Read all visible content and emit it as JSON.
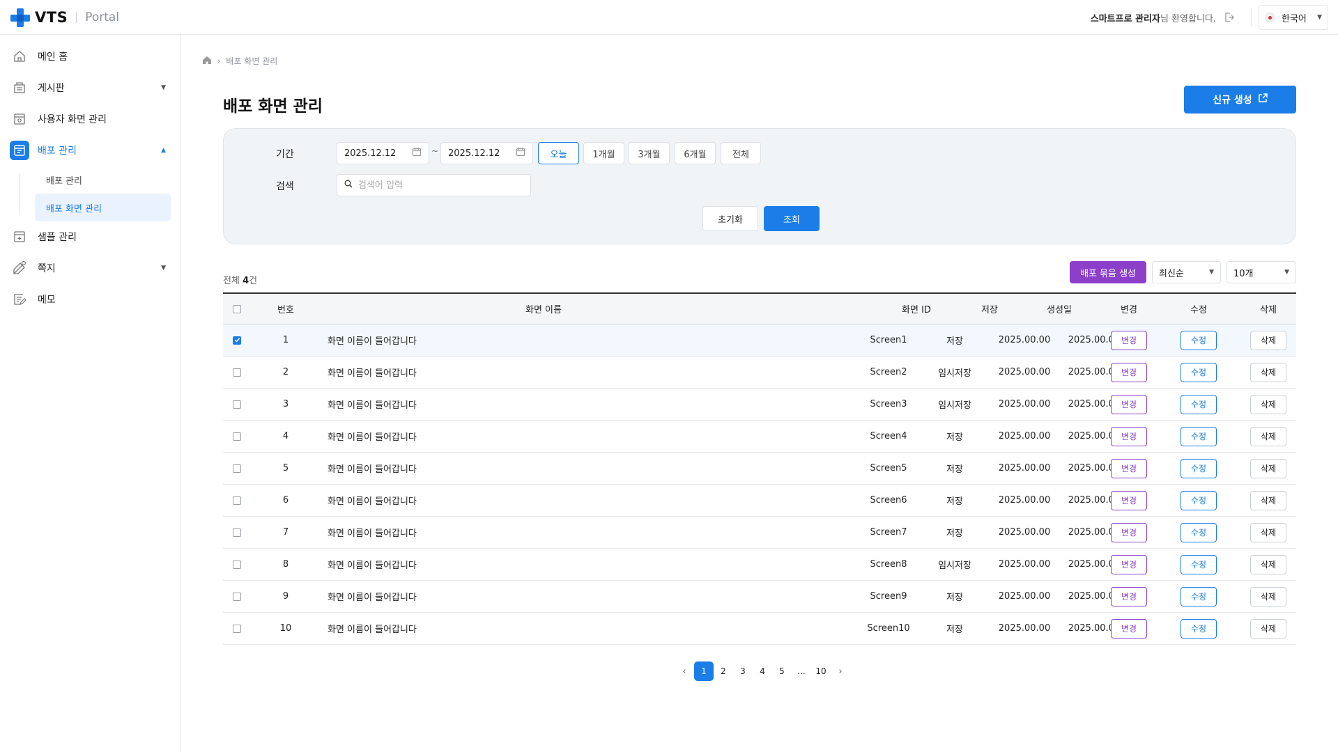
{
  "header": {
    "logo_text": "VTS",
    "logo_sub": "Portal",
    "welcome_name": "스마트프로 관리자",
    "welcome_suffix": "님 환영합니다.",
    "language": "한국어"
  },
  "sidebar": {
    "items": [
      {
        "label": "메인 홈",
        "icon": "home-icon"
      },
      {
        "label": "게시판",
        "icon": "board-icon"
      },
      {
        "label": "사용자 화면 관리",
        "icon": "screen-settings-icon"
      },
      {
        "label": "배포 관리",
        "icon": "deploy-icon"
      },
      {
        "label": "샘플 관리",
        "icon": "sample-icon"
      },
      {
        "label": "쪽지",
        "icon": "message-icon"
      },
      {
        "label": "메모",
        "icon": "memo-icon"
      }
    ],
    "sub_items": [
      {
        "label": "배포 관리"
      },
      {
        "label": "배포 화면 관리"
      }
    ]
  },
  "breadcrumb": {
    "current": "배포 화면 관리"
  },
  "page": {
    "title": "배포 화면 관리",
    "new_button": "신규 생성"
  },
  "filter": {
    "period_label": "기간",
    "start_date": "2025.12.12",
    "end_date": "2025.12.12",
    "tilde": "~",
    "periods": [
      "오늘",
      "1개월",
      "3개월",
      "6개월",
      "전체"
    ],
    "search_label": "검색",
    "search_placeholder": "검색어 입력",
    "reset_button": "초기화",
    "query_button": "조회"
  },
  "list": {
    "total_prefix": "전체 ",
    "total_count": "4",
    "total_suffix": "건",
    "bundle_button": "배포 묶음 생성",
    "sort_value": "최신순",
    "page_size_value": "10개"
  },
  "table": {
    "headers": {
      "no": "번호",
      "name": "화면 이름",
      "id": "화면 ID",
      "save": "저장",
      "created": "생성일",
      "change": "변경",
      "edit": "수정",
      "delete": "삭제"
    },
    "rows": [
      {
        "no": "1",
        "name": "화면 이름이 들어갑니다",
        "id": "Screen1",
        "save": "저장",
        "saved_date": "2025.00.00",
        "created": "2025.00.00",
        "change": "변경",
        "edit": "수정",
        "delete": "삭제"
      },
      {
        "no": "2",
        "name": "화면 이름이 들어갑니다",
        "id": "Screen2",
        "save": "임시저장",
        "saved_date": "2025.00.00",
        "created": "2025.00.00",
        "change": "변경",
        "edit": "수정",
        "delete": "삭제"
      },
      {
        "no": "3",
        "name": "화면 이름이 들어갑니다",
        "id": "Screen3",
        "save": "임시저장",
        "saved_date": "2025.00.00",
        "created": "2025.00.00",
        "change": "변경",
        "edit": "수정",
        "delete": "삭제"
      },
      {
        "no": "4",
        "name": "화면 이름이 들어갑니다",
        "id": "Screen4",
        "save": "저장",
        "saved_date": "2025.00.00",
        "created": "2025.00.00",
        "change": "변경",
        "edit": "수정",
        "delete": "삭제"
      },
      {
        "no": "5",
        "name": "화면 이름이 들어갑니다",
        "id": "Screen5",
        "save": "저장",
        "saved_date": "2025.00.00",
        "created": "2025.00.00",
        "change": "변경",
        "edit": "수정",
        "delete": "삭제"
      },
      {
        "no": "6",
        "name": "화면 이름이 들어갑니다",
        "id": "Screen6",
        "save": "저장",
        "saved_date": "2025.00.00",
        "created": "2025.00.00",
        "change": "변경",
        "edit": "수정",
        "delete": "삭제"
      },
      {
        "no": "7",
        "name": "화면 이름이 들어갑니다",
        "id": "Screen7",
        "save": "저장",
        "saved_date": "2025.00.00",
        "created": "2025.00.00",
        "change": "변경",
        "edit": "수정",
        "delete": "삭제"
      },
      {
        "no": "8",
        "name": "화면 이름이 들어갑니다",
        "id": "Screen8",
        "save": "임시저장",
        "saved_date": "2025.00.00",
        "created": "2025.00.00",
        "change": "변경",
        "edit": "수정",
        "delete": "삭제"
      },
      {
        "no": "9",
        "name": "화면 이름이 들어갑니다",
        "id": "Screen9",
        "save": "저장",
        "saved_date": "2025.00.00",
        "created": "2025.00.00",
        "change": "변경",
        "edit": "수정",
        "delete": "삭제"
      },
      {
        "no": "10",
        "name": "화면 이름이 들어갑니다",
        "id": "Screen10",
        "save": "저장",
        "saved_date": "2025.00.00",
        "created": "2025.00.00",
        "change": "변경",
        "edit": "수정",
        "delete": "삭제"
      }
    ]
  },
  "pagination": {
    "pages": [
      "1",
      "2",
      "3",
      "4",
      "5",
      "...",
      "10"
    ],
    "current": "1"
  },
  "colors": {
    "primary": "#1a7de8",
    "purple": "#8c3fc9",
    "filter_bg": "#f1f4f7"
  }
}
